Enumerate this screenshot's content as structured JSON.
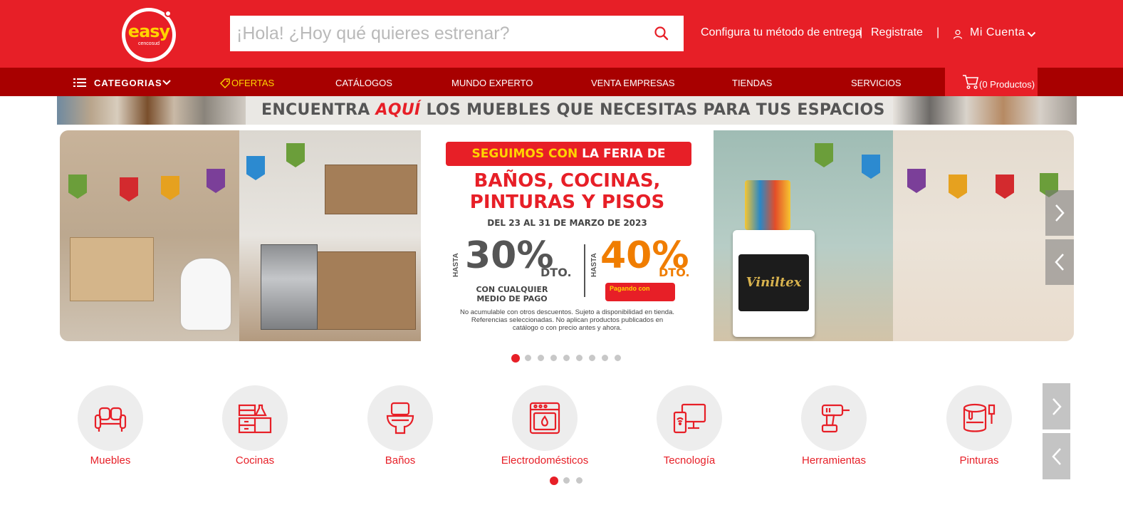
{
  "brand": {
    "name": "easy",
    "subname": "cencosud",
    "primary_color": "#e71f27",
    "dark_color": "#a80000",
    "accent_color": "#ffd400"
  },
  "search": {
    "placeholder": "¡Hola! ¿Hoy qué quieres estrenar?",
    "value": "",
    "icon": "search-icon"
  },
  "header_links": {
    "delivery": "Configura tu método de entrega",
    "separator": "|",
    "register": "Registrate",
    "account": "Mi Cuenta"
  },
  "nav": {
    "categories": "CATEGORIAS",
    "items": [
      "OFERTAS",
      "CATÁLOGOS",
      "MUNDO EXPERTO",
      "VENTA EMPRESAS",
      "TIENDAS",
      "SERVICIOS"
    ],
    "cart": "(0 Productos)"
  },
  "promo_strip": {
    "part1": "ENCUENTRA ",
    "highlight": "AQUÍ",
    "part2": " LOS MUEBLES QUE NECESITAS PARA TUS ESPACIOS"
  },
  "hero": {
    "ribbon_a": "SEGUIMOS CON ",
    "ribbon_b": "LA FERIA DE",
    "title_line1": "BAÑOS, COCINAS,",
    "title_line2": "PINTURAS Y PISOS",
    "dates": "DEL 23 AL 31 DE MARZO DE 2023",
    "hasta": "HASTA",
    "discount1": "30%",
    "discount2": "40%",
    "dto": "DTO.",
    "pay_line1": "CON CUALQUIER",
    "pay_line2": "MEDIO DE PAGO",
    "pagando": "Pagando con",
    "disclaimer1": "No acumulable con otros descuentos. Sujeto a disponibilidad en tienda.",
    "disclaimer2": "Referencias seleccionadas. No aplican productos publicados en",
    "disclaimer3": "catálogo o con precio antes y ahora.",
    "bucket_brand": "Viniltex",
    "slide_count": 9,
    "active_slide": 1
  },
  "categories": {
    "items": [
      {
        "label": "Muebles",
        "icon": "sofa-icon"
      },
      {
        "label": "Cocinas",
        "icon": "kitchen-icon"
      },
      {
        "label": "Baños",
        "icon": "toilet-icon"
      },
      {
        "label": "Electrodomésticos",
        "icon": "oven-icon"
      },
      {
        "label": "Tecnología",
        "icon": "devices-icon"
      },
      {
        "label": "Herramientas",
        "icon": "drill-icon"
      },
      {
        "label": "Pinturas",
        "icon": "paint-bucket-icon"
      }
    ],
    "page_count": 3,
    "active_page": 1
  }
}
